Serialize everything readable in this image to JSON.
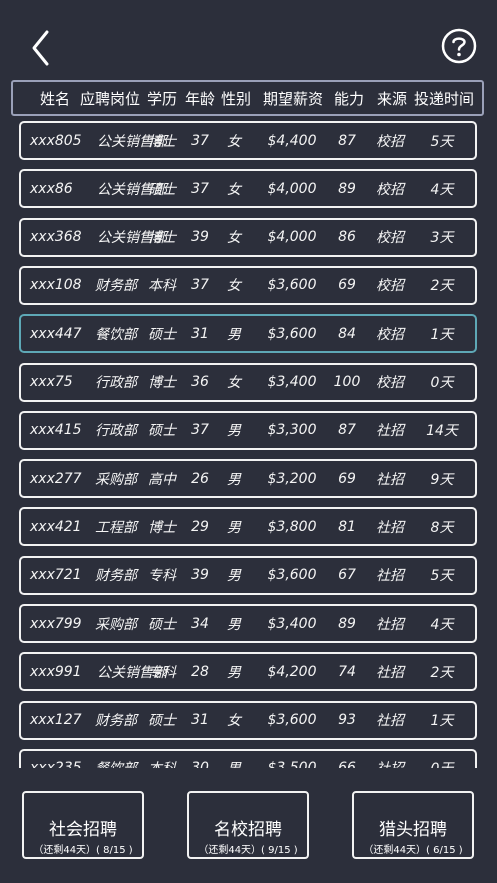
{
  "header": {
    "columns": [
      "姓名",
      "应聘岗位",
      "学历",
      "年龄",
      "性别",
      "期望薪资",
      "能力",
      "来源",
      "投递时间"
    ]
  },
  "rows": [
    {
      "name": "xxx805",
      "dept": "公关销售部",
      "edu": "博士",
      "age": "37",
      "gender": "女",
      "salary": "$4,400",
      "ability": "87",
      "source": "校招",
      "time": "5天"
    },
    {
      "name": "xxx86",
      "dept": "公关销售部",
      "edu": "硕士",
      "age": "37",
      "gender": "女",
      "salary": "$4,000",
      "ability": "89",
      "source": "校招",
      "time": "4天"
    },
    {
      "name": "xxx368",
      "dept": "公关销售部",
      "edu": "博士",
      "age": "39",
      "gender": "女",
      "salary": "$4,000",
      "ability": "86",
      "source": "校招",
      "time": "3天"
    },
    {
      "name": "xxx108",
      "dept": "财务部",
      "edu": "本科",
      "age": "37",
      "gender": "女",
      "salary": "$3,600",
      "ability": "69",
      "source": "校招",
      "time": "2天"
    },
    {
      "name": "xxx447",
      "dept": "餐饮部",
      "edu": "硕士",
      "age": "31",
      "gender": "男",
      "salary": "$3,600",
      "ability": "84",
      "source": "校招",
      "time": "1天"
    },
    {
      "name": "xxx75",
      "dept": "行政部",
      "edu": "博士",
      "age": "36",
      "gender": "女",
      "salary": "$3,400",
      "ability": "100",
      "source": "校招",
      "time": "0天"
    },
    {
      "name": "xxx415",
      "dept": "行政部",
      "edu": "硕士",
      "age": "37",
      "gender": "男",
      "salary": "$3,300",
      "ability": "87",
      "source": "社招",
      "time": "14天"
    },
    {
      "name": "xxx277",
      "dept": "采购部",
      "edu": "高中",
      "age": "26",
      "gender": "男",
      "salary": "$3,200",
      "ability": "69",
      "source": "社招",
      "time": "9天"
    },
    {
      "name": "xxx421",
      "dept": "工程部",
      "edu": "博士",
      "age": "29",
      "gender": "男",
      "salary": "$3,800",
      "ability": "81",
      "source": "社招",
      "time": "8天"
    },
    {
      "name": "xxx721",
      "dept": "财务部",
      "edu": "专科",
      "age": "39",
      "gender": "男",
      "salary": "$3,600",
      "ability": "67",
      "source": "社招",
      "time": "5天"
    },
    {
      "name": "xxx799",
      "dept": "采购部",
      "edu": "硕士",
      "age": "34",
      "gender": "男",
      "salary": "$3,400",
      "ability": "89",
      "source": "社招",
      "time": "4天"
    },
    {
      "name": "xxx991",
      "dept": "公关销售部",
      "edu": "专科",
      "age": "28",
      "gender": "男",
      "salary": "$4,200",
      "ability": "74",
      "source": "社招",
      "time": "2天"
    },
    {
      "name": "xxx127",
      "dept": "财务部",
      "edu": "硕士",
      "age": "31",
      "gender": "女",
      "salary": "$3,600",
      "ability": "93",
      "source": "社招",
      "time": "1天"
    },
    {
      "name": "xxx235",
      "dept": "餐饮部",
      "edu": "本科",
      "age": "30",
      "gender": "男",
      "salary": "$3,500",
      "ability": "66",
      "source": "社招",
      "time": "0天"
    }
  ],
  "selected_row_index": 4,
  "footer": {
    "buttons": [
      {
        "title": "社会招聘",
        "sub": "（还剩44天）( 8/15 )"
      },
      {
        "title": "名校招聘",
        "sub": "（还剩44天）( 9/15 )"
      },
      {
        "title": "猎头招聘",
        "sub": "（还剩44天）( 6/15 )"
      }
    ]
  },
  "icons": {
    "back": "chevron-left-icon",
    "help": "question-circle-icon"
  },
  "colors": {
    "background": "#2c2f3b",
    "border": "#f2f2f2",
    "selected_border": "#5ea8b6",
    "header_border": "#9aa0b8"
  }
}
